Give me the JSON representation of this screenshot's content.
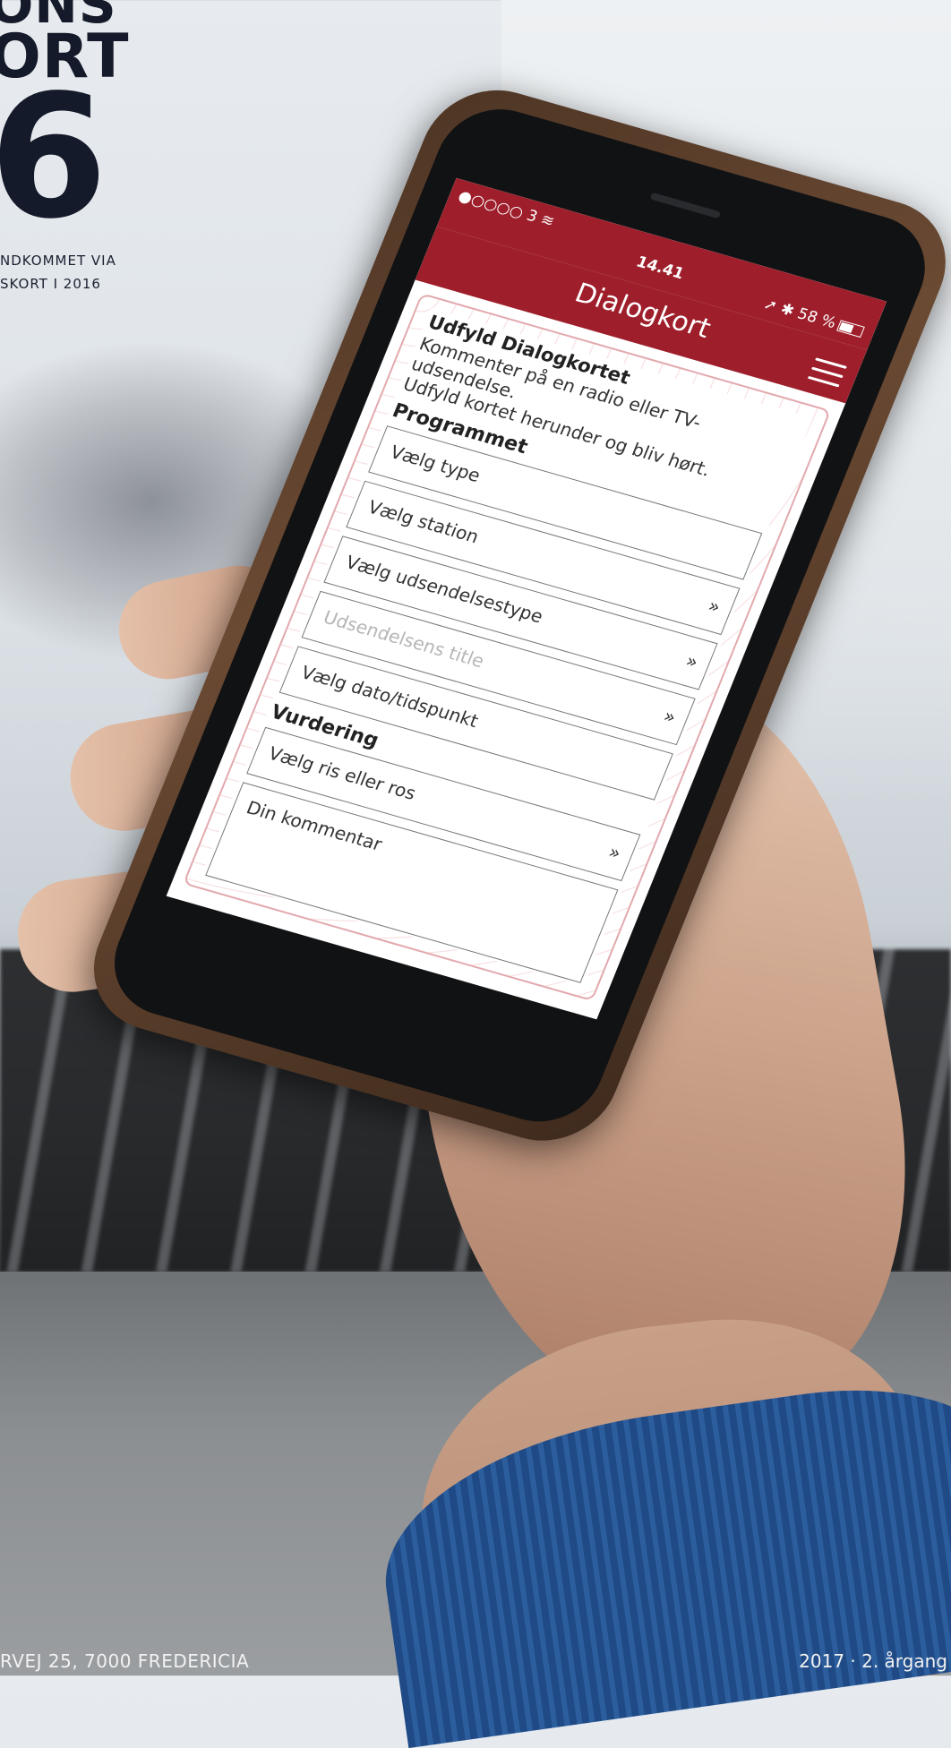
{
  "magazine": {
    "masthead_line1": "ONS",
    "masthead_line2": "ORT",
    "masthead_big": "6",
    "sub_line1": "NDKOMMET VIA",
    "sub_line2": "SKORT I 2016",
    "footer_left": "RVEJ 25, 7000 FREDERICIA",
    "footer_right": "2017 · 2. årgang"
  },
  "phone": {
    "status": {
      "signal": "●○○○○ 3 ",
      "wifi_icon": "wifi-icon",
      "time": "14.41",
      "right": "➚ ✱ 58 %"
    },
    "app_title": "Dialogkort",
    "form": {
      "heading": "Udfyld Dialogkortet",
      "intro_line1": "Kommenter på en radio eller TV-udsendelse.",
      "intro_line2": "Udfyld kortet herunder og bliv hørt.",
      "section_program": "Programmet",
      "fields": [
        {
          "label": "Vælg type",
          "placeholder": false
        },
        {
          "label": "Vælg station",
          "placeholder": false
        },
        {
          "label": "Vælg udsendelsestype",
          "placeholder": false
        },
        {
          "label": "Udsendelsens title",
          "placeholder": true
        },
        {
          "label": "Vælg dato/tidspunkt",
          "placeholder": false
        }
      ],
      "section_rating": "Vurdering",
      "rating_field": "Vælg ris eller ros",
      "comment_label": "Din kommentar",
      "chevron": "»"
    }
  },
  "colors": {
    "app_red": "#9e1f2b",
    "masthead_navy": "#151a2a",
    "sleeve_blue": "#1f4a86"
  }
}
